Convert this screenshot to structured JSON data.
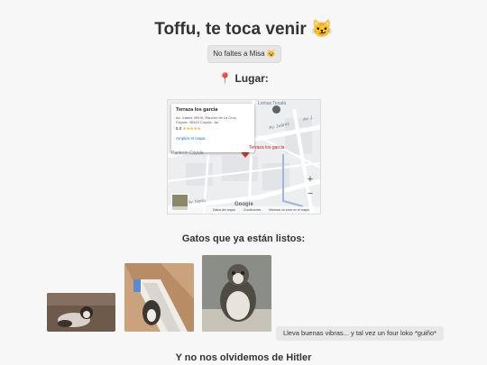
{
  "page": {
    "title": "Toffu, te toca venir 😼",
    "button_label": "No faltes a Misa 😼",
    "place_heading": "📍 Lugar:",
    "cats_heading": "Gatos que ya están listos:",
    "bubble_text": "Lleva buenas vibras... y tal vez un four loko *guiño*",
    "bottom_heading": "Y no nos olvidemos de Hitler"
  },
  "map": {
    "place_name": "Terraza los garcia",
    "address": "Av. Juárez 399 B, Rancho de La Cruz, Coyula, 45410 Coyula, Jal.",
    "rating": "5.0",
    "stars": "★★★★★",
    "enlarge_link": "Ampliar el mapa",
    "pin_label": "Terraza los garcia",
    "street_labels": [
      "Lomas Tonalá",
      "Av. Juárez",
      "Av. J",
      "Panteón Coyula",
      "Av. Noria"
    ],
    "zoom_in": "+",
    "zoom_out": "−",
    "footer": {
      "logo": "Google",
      "map_data": "Datos del mapa",
      "terms": "Condiciones",
      "report": "Informar un error en el mapa"
    },
    "colors": {
      "pin": "#d23f31",
      "road": "#ffffff",
      "background": "#eef0f2"
    }
  },
  "photos": [
    {
      "name": "cat-photo-1",
      "colors": [
        "#6e5a4a",
        "#d9d2c7",
        "#2f2a26"
      ]
    },
    {
      "name": "cat-photo-2",
      "colors": [
        "#caa27c",
        "#3b3733",
        "#f0ede8"
      ]
    },
    {
      "name": "cat-photo-3",
      "colors": [
        "#8b8d88",
        "#c7c3b8",
        "#4e4a44"
      ]
    }
  ]
}
